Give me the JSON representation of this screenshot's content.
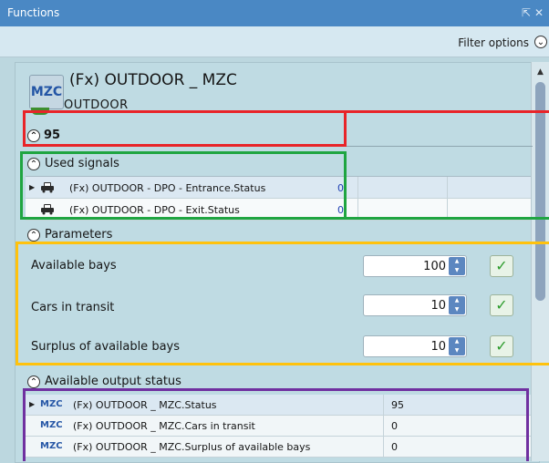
{
  "window": {
    "title": "Functions",
    "pin_glyph": "↕",
    "close_glyph": "✕"
  },
  "filter": {
    "label": "Filter options",
    "toggle_glyph": "⌄"
  },
  "function": {
    "logo": "MZC",
    "title": "(Fx) OUTDOOR _ MZC",
    "subtitle": "OUTDOOR",
    "value": "95"
  },
  "used_signals": {
    "header": "Used signals",
    "rows": [
      {
        "name": "(Fx) OUTDOOR - DPO - Entrance.Status",
        "value": "0"
      },
      {
        "name": "(Fx) OUTDOOR - DPO - Exit.Status",
        "value": "0"
      }
    ]
  },
  "parameters": {
    "header": "Parameters",
    "items": [
      {
        "label": "Available bays",
        "value": "100"
      },
      {
        "label": "Cars in transit",
        "value": "10"
      },
      {
        "label": "Surplus of available bays",
        "value": "10"
      }
    ]
  },
  "output": {
    "header": "Available output status",
    "rows": [
      {
        "tag": "MZC",
        "name": "(Fx) OUTDOOR _ MZC.Status",
        "value": "95"
      },
      {
        "tag": "MZC",
        "name": "(Fx) OUTDOOR _ MZC.Cars in transit",
        "value": "0"
      },
      {
        "tag": "MZC",
        "name": "(Fx) OUTDOOR _ MZC.Surplus of available bays",
        "value": "0"
      }
    ]
  },
  "colors": {
    "highlight_red": "#e82429",
    "highlight_green": "#1fa541",
    "highlight_yellow": "#ffc20d",
    "highlight_purple": "#7030a0"
  }
}
